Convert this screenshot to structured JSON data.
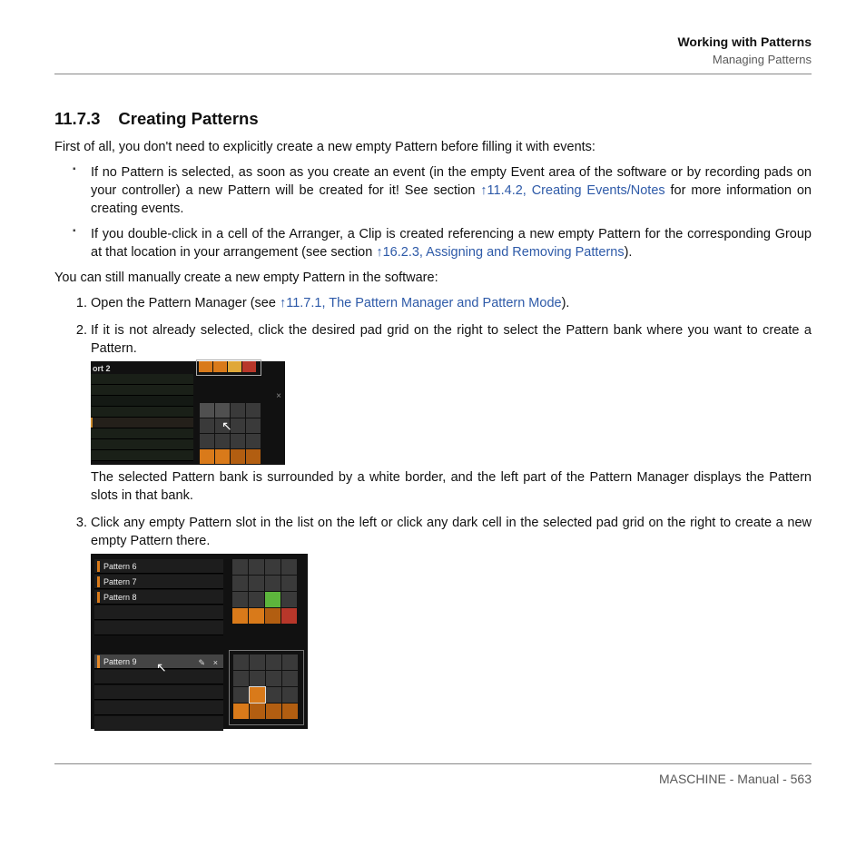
{
  "header": {
    "chapter": "Working with Patterns",
    "section": "Managing Patterns"
  },
  "section": {
    "number": "11.7.3",
    "title": "Creating Patterns"
  },
  "intro": "First of all, you don't need to explicitly create a new empty Pattern before filling it with events:",
  "bullets": [
    {
      "pre": "If no Pattern is selected, as soon as you create an event (in the empty Event area of the software or by recording pads on your controller) a new Pattern will be created for it! See section ",
      "link": "↑11.4.2, Creating Events/Notes",
      "post": " for more information on creating events."
    },
    {
      "pre": "If you double-click in a cell of the Arranger, a Clip is created referencing a new empty Pattern for the corresponding Group at that location in your arrangement (see section ",
      "link": "↑16.2.3, Assigning and Removing Patterns",
      "post": ")."
    }
  ],
  "mid": "You can still manually create a new empty Pattern in the software:",
  "steps": [
    {
      "pre": "Open the Pattern Manager (see ",
      "link": "↑11.7.1, The Pattern Manager and Pattern Mode",
      "post": ")."
    },
    {
      "text": "If it is not already selected, click the desired pad grid on the right to select the Pattern bank where you want to create a Pattern.",
      "after": "The selected Pattern bank is surrounded by a white border, and the left part of the Pattern Manager displays the Pattern slots in that bank."
    },
    {
      "text": "Click any empty Pattern slot in the list on the left or click any dark cell in the selected pad grid on the right to create a new empty Pattern there."
    }
  ],
  "fig1": {
    "label": "ort 2",
    "close": "×"
  },
  "fig2": {
    "slots": [
      "Pattern 6",
      "Pattern 7",
      "Pattern 8"
    ],
    "selected": "Pattern 9",
    "close": "×",
    "pencil": "✎"
  },
  "footer": "MASCHINE - Manual - 563"
}
